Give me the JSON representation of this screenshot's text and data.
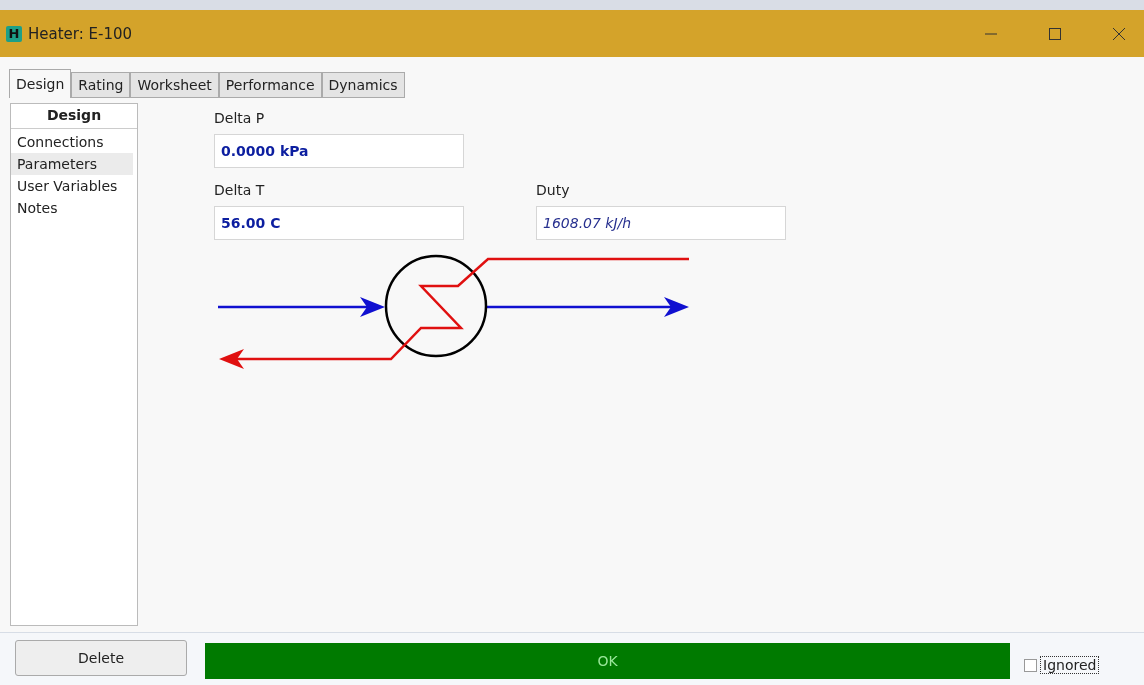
{
  "window": {
    "title": "Heater: E-100",
    "app_icon": "H"
  },
  "tabs": [
    {
      "label": "Design",
      "selected": true
    },
    {
      "label": "Rating",
      "selected": false
    },
    {
      "label": "Worksheet",
      "selected": false
    },
    {
      "label": "Performance",
      "selected": false
    },
    {
      "label": "Dynamics",
      "selected": false
    }
  ],
  "sidebar": {
    "header": "Design",
    "items": [
      {
        "label": "Connections",
        "selected": false
      },
      {
        "label": "Parameters",
        "selected": true
      },
      {
        "label": "User Variables",
        "selected": false
      },
      {
        "label": "Notes",
        "selected": false
      }
    ]
  },
  "fields": [
    {
      "label": "Delta P",
      "value": "0.0000 kPa",
      "kind": "specified"
    },
    {
      "label": "Delta T",
      "value": "56.00 C",
      "kind": "specified"
    },
    {
      "label": "Duty",
      "value": "1608.07 kJ/h",
      "kind": "calculated"
    }
  ],
  "footer": {
    "delete_button": "Delete",
    "status": {
      "text": "OK",
      "color": "#007a00"
    },
    "ignored": {
      "label": "Ignored",
      "checked": false
    }
  }
}
